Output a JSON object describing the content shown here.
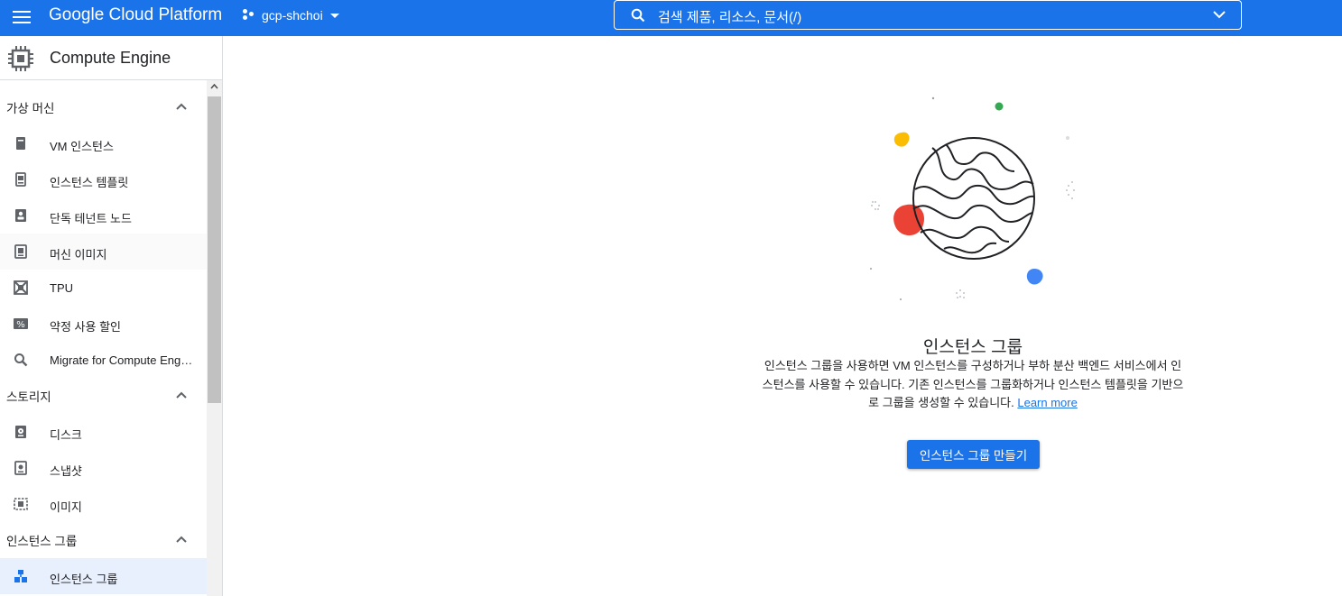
{
  "topbar": {
    "brand": "Google Cloud Platform",
    "project": "gcp-shchoi",
    "search_placeholder": "검색   제품, 리소스, 문서(/)"
  },
  "sidebar": {
    "title": "Compute Engine",
    "sections": [
      {
        "label": "가상 머신",
        "items": [
          {
            "label": "VM 인스턴스",
            "icon": "vm-instance-icon"
          },
          {
            "label": "인스턴스 템플릿",
            "icon": "template-icon"
          },
          {
            "label": "단독 테넌트 노드",
            "icon": "sole-tenant-icon"
          },
          {
            "label": "머신 이미지",
            "icon": "machine-image-icon"
          },
          {
            "label": "TPU",
            "icon": "tpu-icon"
          },
          {
            "label": "약정 사용 할인",
            "icon": "percent-icon"
          },
          {
            "label": "Migrate for Compute Engine",
            "icon": "search-icon"
          }
        ]
      },
      {
        "label": "스토리지",
        "items": [
          {
            "label": "디스크",
            "icon": "disk-icon"
          },
          {
            "label": "스냅샷",
            "icon": "snapshot-icon"
          },
          {
            "label": "이미지",
            "icon": "image-icon"
          }
        ]
      },
      {
        "label": "인스턴스 그룹",
        "items": [
          {
            "label": "인스턴스 그룹",
            "icon": "instance-group-icon"
          }
        ]
      }
    ]
  },
  "main": {
    "title": "인스턴스 그룹",
    "description": "인스턴스 그룹을 사용하면 VM 인스턴스를 구성하거나 부하 분산 백엔드 서비스에서 인스턴스를 사용할 수 있습니다. 기존 인스턴스를 그룹화하거나 인스턴스 템플릿을 기반으로 그룹을 생성할 수 있습니다.",
    "learn_more": "Learn more",
    "create_button": "인스턴스 그룹 만들기"
  },
  "colors": {
    "primary": "#1a73e8",
    "yellow": "#fbbc04",
    "red": "#ea4335",
    "green": "#34a853",
    "blue": "#4285f4"
  }
}
